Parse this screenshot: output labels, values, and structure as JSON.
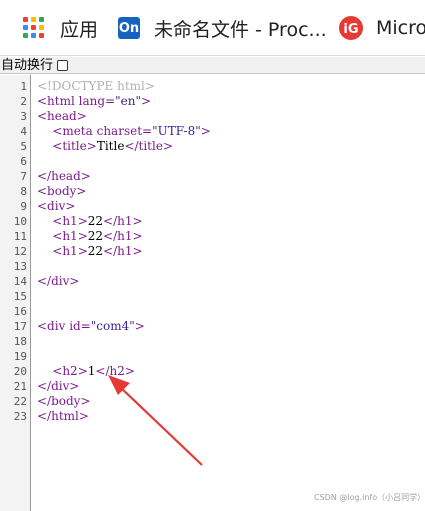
{
  "bookmarks_bar": {
    "items": [
      {
        "label": "应用",
        "icon": "apps-grid-icon"
      },
      {
        "label": "未命名文件 - Proc...",
        "icon": "processon-icon",
        "icon_text": "On"
      },
      {
        "label": "Micro",
        "icon": "microsoft-logo-icon"
      }
    ]
  },
  "toolbar": {
    "wrap_label": "自动换行",
    "wrap_checked": false
  },
  "editor": {
    "line_numbers": [
      "1",
      "2",
      "3",
      "4",
      "5",
      "6",
      "7",
      "8",
      "9",
      "10",
      "11",
      "12",
      "13",
      "14",
      "15",
      "16",
      "17",
      "18",
      "19",
      "20",
      "21",
      "22",
      "23"
    ],
    "lines": [
      {
        "text": "<!DOCTYPE html>"
      },
      {
        "text": "<html lang=\"en\">"
      },
      {
        "text": "<head>"
      },
      {
        "text": "    <meta charset=\"UTF-8\">"
      },
      {
        "text": "    <title>Title</title>"
      },
      {
        "text": ""
      },
      {
        "text": "</head>"
      },
      {
        "text": "<body>"
      },
      {
        "text": "<div>"
      },
      {
        "text": "    <h1>22</h1>"
      },
      {
        "text": "    <h1>22</h1>"
      },
      {
        "text": "    <h1>22</h1>"
      },
      {
        "text": ""
      },
      {
        "text": "</div>"
      },
      {
        "text": ""
      },
      {
        "text": ""
      },
      {
        "text": "<div id=\"com4\">"
      },
      {
        "text": ""
      },
      {
        "text": ""
      },
      {
        "text": "    <h2>1</h2>"
      },
      {
        "text": "</div>"
      },
      {
        "text": "</body>"
      },
      {
        "text": "</html>"
      }
    ]
  },
  "annotation": {
    "arrow_color": "#e53935"
  },
  "watermark": "CSDN @log.info（小吕同学）",
  "colors": {
    "tag": "#7a1c8a",
    "string": "#3a1f8f",
    "doctype": "#b0b0b0"
  }
}
